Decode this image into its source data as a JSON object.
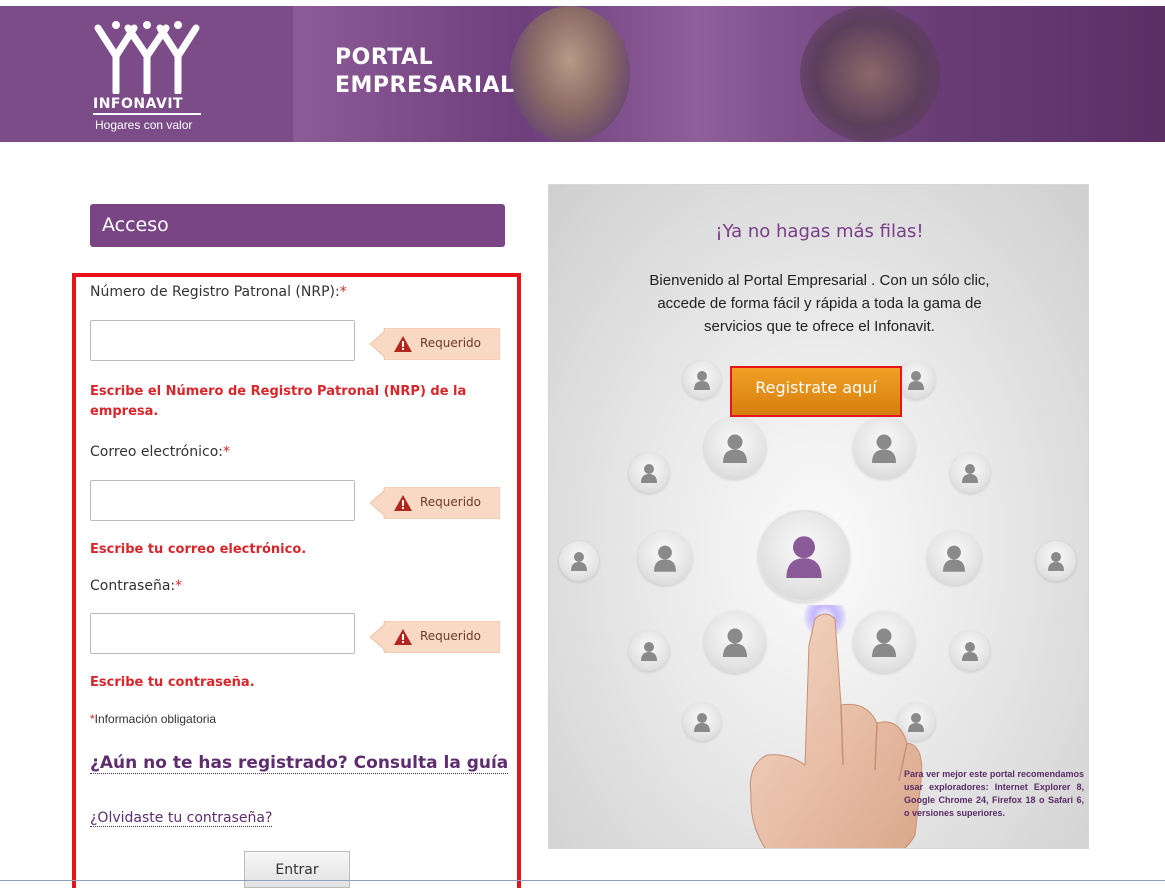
{
  "header": {
    "brand_name": "INFONAVIT",
    "brand_tagline": "Hogares con valor",
    "portal_title_line1": "PORTAL",
    "portal_title_line2": "EMPRESARIAL"
  },
  "login": {
    "section_title": "Acceso",
    "fields": [
      {
        "label": "Número de Registro Patronal (NRP):",
        "required_mark": "*",
        "value": "",
        "tooltip": "Requerido",
        "error": "Escribe el Número de Registro Patronal (NRP) de la empresa."
      },
      {
        "label": "Correo electrónico:",
        "required_mark": "*",
        "value": "",
        "tooltip": "Requerido",
        "error": "Escribe tu correo electrónico."
      },
      {
        "label": "Contraseña:",
        "required_mark": "*",
        "value": "",
        "tooltip": "Requerido",
        "error": "Escribe tu contraseña."
      }
    ],
    "required_note_mark": "*",
    "required_note": "Información obligatoria",
    "guide_link": "¿Aún no te has registrado? Consulta la guía",
    "forgot_link": "¿Olvidaste tu contraseña?",
    "submit_label": "Entrar"
  },
  "promo": {
    "headline": "¡Ya no hagas más filas!",
    "body_line1": "Bienvenido al Portal Empresarial . Con un sólo clic,",
    "body_line2": "accede de forma fácil y rápida  a toda la gama de",
    "body_line3": "servicios que te ofrece el Infonavit.",
    "register_button": "Registrate aquí",
    "browser_note": "Para ver mejor este portal recomendamos usar exploradores: Internet Explorer 8, Google Chrome 24, Firefox 18 o Safari 6, o versiones superiores."
  },
  "colors": {
    "brand_purple": "#7a4585",
    "error_red": "#d9262b",
    "highlight_red": "#e8131b",
    "register_orange": "#e88f18"
  }
}
